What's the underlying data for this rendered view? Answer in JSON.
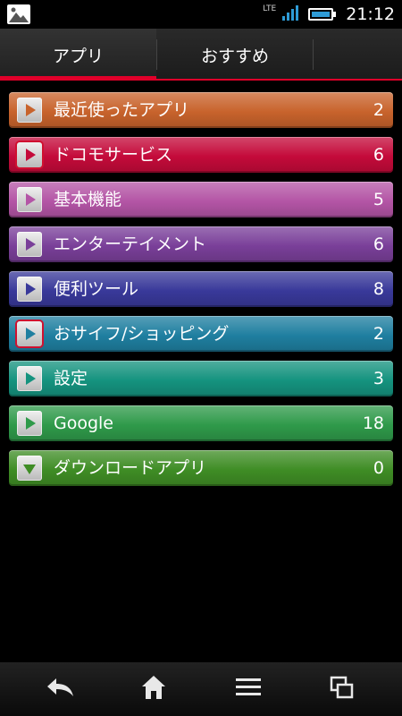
{
  "status_bar": {
    "network": "LTE",
    "time": "21:12"
  },
  "tabs": [
    {
      "label": "アプリ",
      "selected": true
    },
    {
      "label": "おすすめ",
      "selected": false
    }
  ],
  "categories": [
    {
      "label": "最近使ったアプリ",
      "count": "2",
      "color": "#c8632c"
    },
    {
      "label": "ドコモサービス",
      "count": "6",
      "color": "#c40a3a"
    },
    {
      "label": "基本機能",
      "count": "5",
      "color": "#b455a6"
    },
    {
      "label": "エンターテイメント",
      "count": "6",
      "color": "#7a3f99"
    },
    {
      "label": "便利ツール",
      "count": "8",
      "color": "#39399a"
    },
    {
      "label": "おサイフ/ショッピング",
      "count": "2",
      "color": "#1f7fa0"
    },
    {
      "label": "設定",
      "count": "3",
      "color": "#15937f"
    },
    {
      "label": "Google",
      "count": "18",
      "color": "#2f9a4a"
    },
    {
      "label": "ダウンロードアプリ",
      "count": "0",
      "color": "#3f8d25"
    }
  ],
  "nav_icons": [
    "back-icon",
    "home-icon",
    "menu-icon",
    "recent-apps-icon"
  ]
}
